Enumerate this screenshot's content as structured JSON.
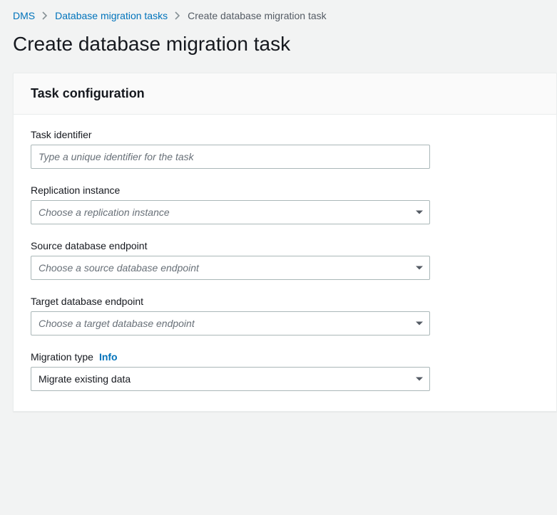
{
  "breadcrumb": {
    "root": "DMS",
    "parent": "Database migration tasks",
    "current": "Create database migration task"
  },
  "page": {
    "title": "Create database migration task"
  },
  "panel": {
    "title": "Task configuration"
  },
  "fields": {
    "task_identifier": {
      "label": "Task identifier",
      "placeholder": "Type a unique identifier for the task",
      "value": ""
    },
    "replication_instance": {
      "label": "Replication instance",
      "placeholder": "Choose a replication instance",
      "value": ""
    },
    "source_endpoint": {
      "label": "Source database endpoint",
      "placeholder": "Choose a source database endpoint",
      "value": ""
    },
    "target_endpoint": {
      "label": "Target database endpoint",
      "placeholder": "Choose a target database endpoint",
      "value": ""
    },
    "migration_type": {
      "label": "Migration type",
      "info": "Info",
      "value": "Migrate existing data"
    }
  }
}
